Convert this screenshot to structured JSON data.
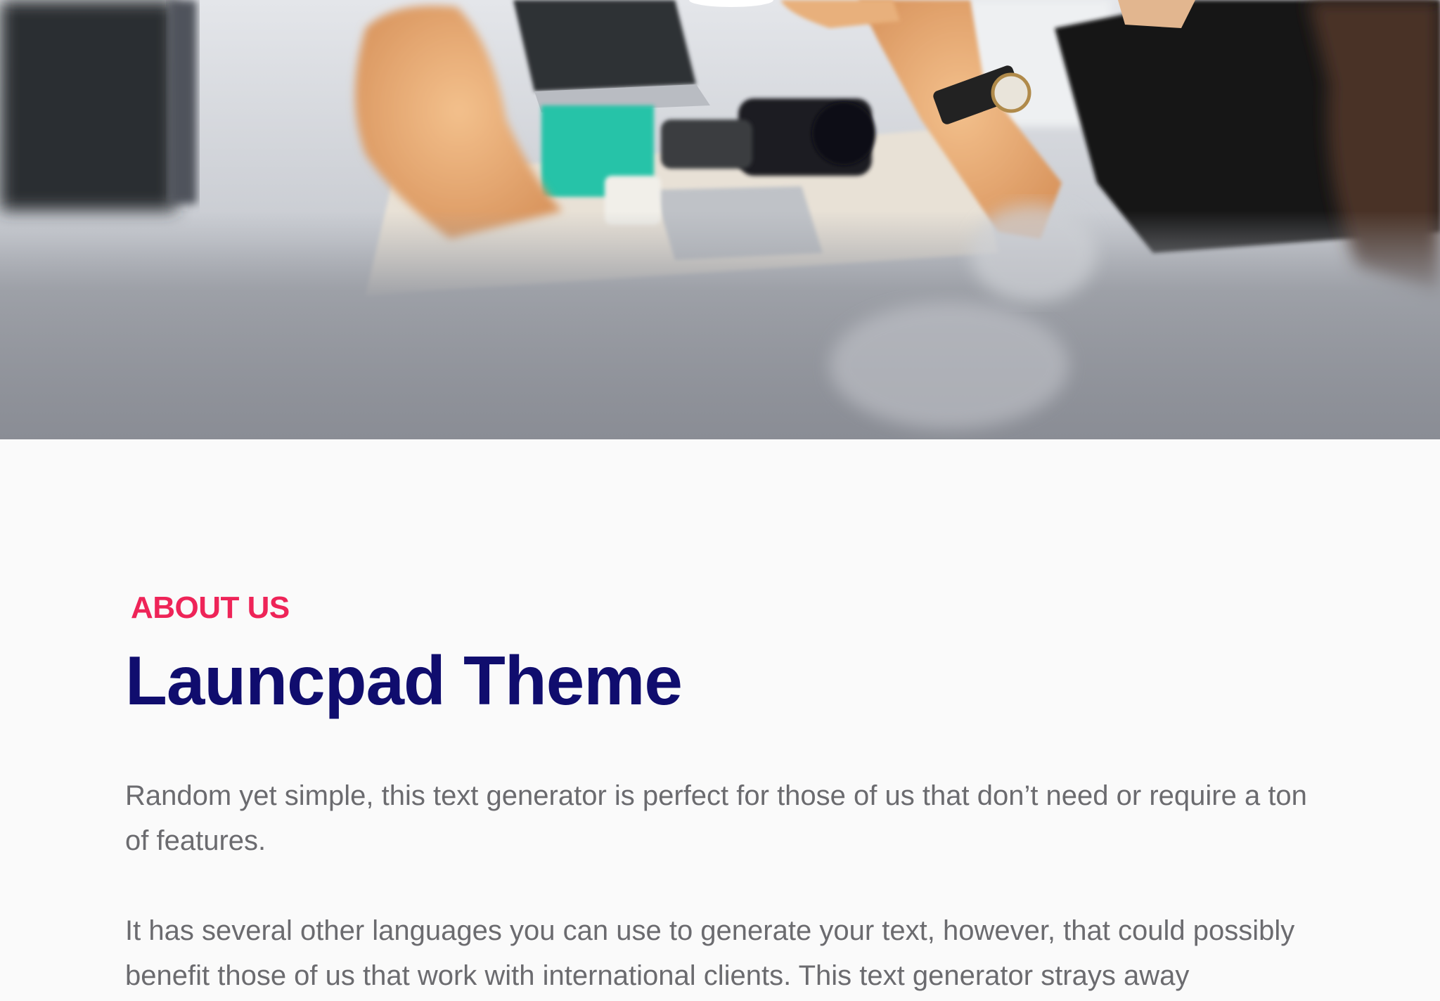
{
  "hero": {
    "image": "team-meeting-photo"
  },
  "about": {
    "eyebrow": "ABOUT US",
    "title": "Launcpad Theme",
    "paragraphs": [
      "Random yet simple, this text generator is perfect for those of us that don’t need or require a ton of features.",
      "It has several other languages you can use to generate your text, however, that could possibly benefit those of us that work with international clients. This text generator strays away"
    ]
  },
  "colors": {
    "eyebrow": "#ee2458",
    "title": "#100d6e",
    "body_text": "#6b6b6f",
    "background": "#fafafa"
  }
}
